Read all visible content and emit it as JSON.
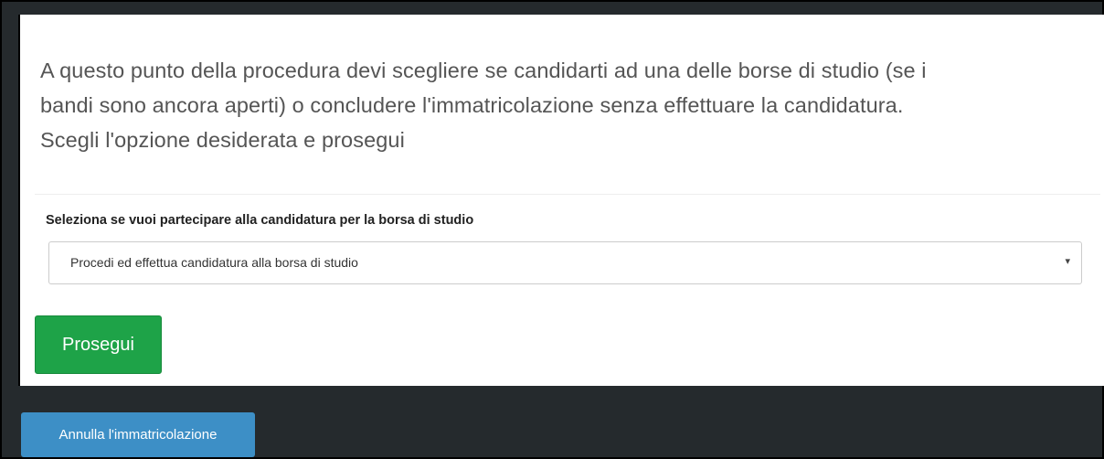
{
  "panel": {
    "intro_line1": "A questo punto della procedura devi scegliere se candidarti ad una delle borse di studio (se i",
    "intro_line2": "bandi sono ancora aperti) o concludere l'immatricolazione senza effettuare la candidatura.",
    "intro_line3": "Scegli l'opzione desiderata e prosegui"
  },
  "form": {
    "label": "Seleziona se vuoi partecipare alla candidatura per la borsa di studio",
    "selected_option": "Procedi ed effettua candidatura alla borsa di studio",
    "arrow_icon": "▾"
  },
  "actions": {
    "continue_label": "Prosegui",
    "cancel_label": "Annulla l'immatricolazione"
  },
  "colors": {
    "primary": "#1ea348",
    "cancel": "#3d8fc6",
    "footer_background": "#252a2d"
  }
}
